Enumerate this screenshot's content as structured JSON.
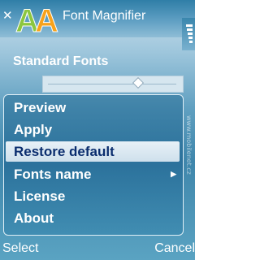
{
  "header": {
    "title": "Font Magnifier",
    "logo_icon": "aa-letters-logo-icon",
    "close_icon": "close-icon",
    "signal_icon": "signal-strength-icon"
  },
  "settings": {
    "label": "Standard Fonts",
    "slider_level": 0.7
  },
  "menu": {
    "items": [
      {
        "label": "Preview"
      },
      {
        "label": "Apply"
      },
      {
        "label": "Restore default",
        "selected": true
      },
      {
        "label": "Fonts name",
        "has_submenu": true
      },
      {
        "label": "License"
      },
      {
        "label": "About"
      }
    ]
  },
  "watermark": "www.mobilenet.cz",
  "softkeys": {
    "left": "Select",
    "right": "Cancel"
  },
  "colors": {
    "selected_text": "#0a2d6e",
    "header_blue": "#2f7ea7",
    "logo_green": "#8cc63f",
    "logo_orange": "#f7a21b"
  }
}
